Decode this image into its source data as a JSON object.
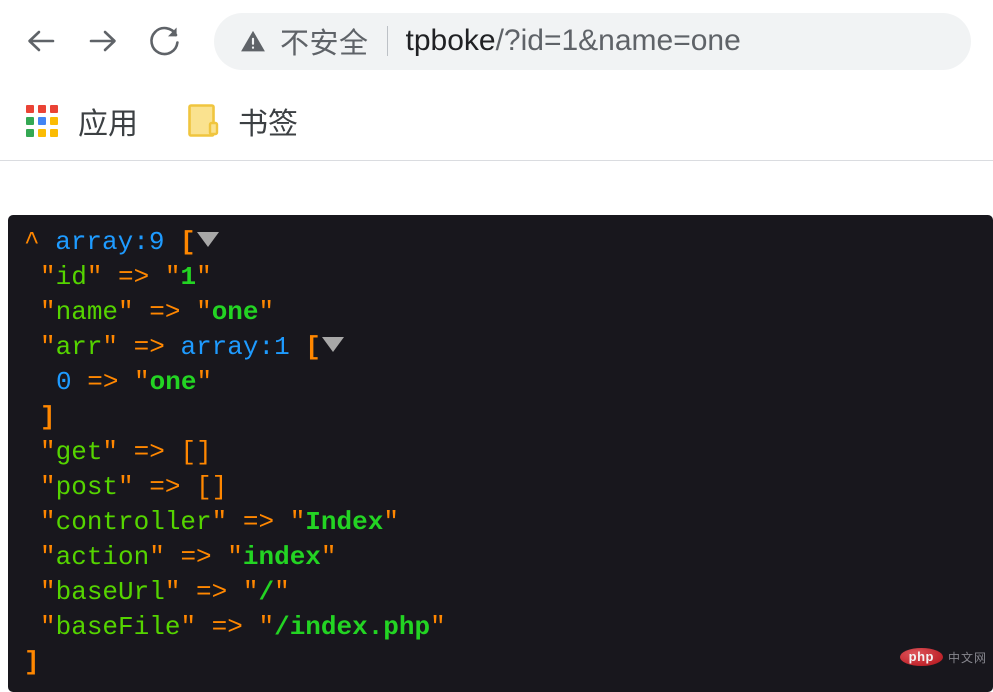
{
  "browser": {
    "nav": {
      "back_label": "Back",
      "forward_label": "Forward",
      "reload_label": "Reload"
    },
    "omnibox": {
      "security_icon": "warning-triangle-icon",
      "security_text": "不安全",
      "url_host": "tpboke",
      "url_path": "/?id=1&name=one",
      "full_url": "tpboke/?id=1&name=one"
    },
    "bookmarks": [
      {
        "icon": "apps-grid-icon",
        "label": "应用"
      },
      {
        "icon": "folder-icon",
        "label": "书签"
      }
    ],
    "apps_grid_colors": [
      "#ea4335",
      "#ea4335",
      "#ea4335",
      "#34a853",
      "#4285f4",
      "#fbbc04",
      "#34a853",
      "#fbbc04",
      "#fbbc04"
    ],
    "folder_color": "#f7d14c"
  },
  "dump": {
    "root_type": "array:9",
    "caret": "^",
    "lines": [
      {
        "indent": 0,
        "html": "<span class=\"t-caret\">^</span> <span class=\"t-type\">array:9</span> <span class=\"t-bracket\">[</span>",
        "toggle": true
      },
      {
        "indent": 1,
        "html": "<span class=\"t-quote\">″</span><span class=\"t-key\">id</span><span class=\"t-quote\">″</span> <span class=\"t-arrow\">=&gt;</span> <span class=\"t-quote\">″</span><span class=\"t-str\">1</span><span class=\"t-quote\">″</span>"
      },
      {
        "indent": 1,
        "html": "<span class=\"t-quote\">″</span><span class=\"t-key\">name</span><span class=\"t-quote\">″</span> <span class=\"t-arrow\">=&gt;</span> <span class=\"t-quote\">″</span><span class=\"t-str\">one</span><span class=\"t-quote\">″</span>"
      },
      {
        "indent": 1,
        "html": "<span class=\"t-quote\">″</span><span class=\"t-key\">arr</span><span class=\"t-quote\">″</span> <span class=\"t-arrow\">=&gt;</span> <span class=\"t-type\">array:1</span> <span class=\"t-bracket\">[</span>",
        "toggle": true
      },
      {
        "indent": 2,
        "html": "<span class=\"t-int\">0</span> <span class=\"t-arrow\">=&gt;</span> <span class=\"t-quote\">″</span><span class=\"t-str\">one</span><span class=\"t-quote\">″</span>"
      },
      {
        "indent": 1,
        "html": "<span class=\"t-bracket\">]</span>"
      },
      {
        "indent": 1,
        "html": "<span class=\"t-quote\">″</span><span class=\"t-key\">get</span><span class=\"t-quote\">″</span> <span class=\"t-arrow\">=&gt;</span> <span class=\"t-empty\">[]</span>"
      },
      {
        "indent": 1,
        "html": "<span class=\"t-quote\">″</span><span class=\"t-key\">post</span><span class=\"t-quote\">″</span> <span class=\"t-arrow\">=&gt;</span> <span class=\"t-empty\">[]</span>"
      },
      {
        "indent": 1,
        "html": "<span class=\"t-quote\">″</span><span class=\"t-key\">controller</span><span class=\"t-quote\">″</span> <span class=\"t-arrow\">=&gt;</span> <span class=\"t-quote\">″</span><span class=\"t-str\">Index</span><span class=\"t-quote\">″</span>"
      },
      {
        "indent": 1,
        "html": "<span class=\"t-quote\">″</span><span class=\"t-key\">action</span><span class=\"t-quote\">″</span> <span class=\"t-arrow\">=&gt;</span> <span class=\"t-quote\">″</span><span class=\"t-str\">index</span><span class=\"t-quote\">″</span>"
      },
      {
        "indent": 1,
        "html": "<span class=\"t-quote\">″</span><span class=\"t-key\">baseUrl</span><span class=\"t-quote\">″</span> <span class=\"t-arrow\">=&gt;</span> <span class=\"t-quote\">″</span><span class=\"t-str\">/</span><span class=\"t-quote\">″</span>"
      },
      {
        "indent": 1,
        "html": "<span class=\"t-quote\">″</span><span class=\"t-key\">baseFile</span><span class=\"t-quote\">″</span> <span class=\"t-arrow\">=&gt;</span> <span class=\"t-quote\">″</span><span class=\"t-str\">/index.php</span><span class=\"t-quote\">″</span>"
      },
      {
        "indent": 0,
        "html": "<span class=\"t-bracket\">]</span>"
      }
    ],
    "values": {
      "id": "1",
      "name": "one",
      "arr": [
        "one"
      ],
      "get": [],
      "post": [],
      "controller": "Index",
      "action": "index",
      "baseUrl": "/",
      "baseFile": "/index.php"
    },
    "colors": {
      "background": "#18171d",
      "type": "#1e9bff",
      "key": "#55d400",
      "string": "#23d423",
      "arrow": "#ff8700",
      "bracket": "#ff8700",
      "toggle": "#a8a8a8"
    }
  },
  "watermark": {
    "badge": "php",
    "text": "中文网"
  }
}
